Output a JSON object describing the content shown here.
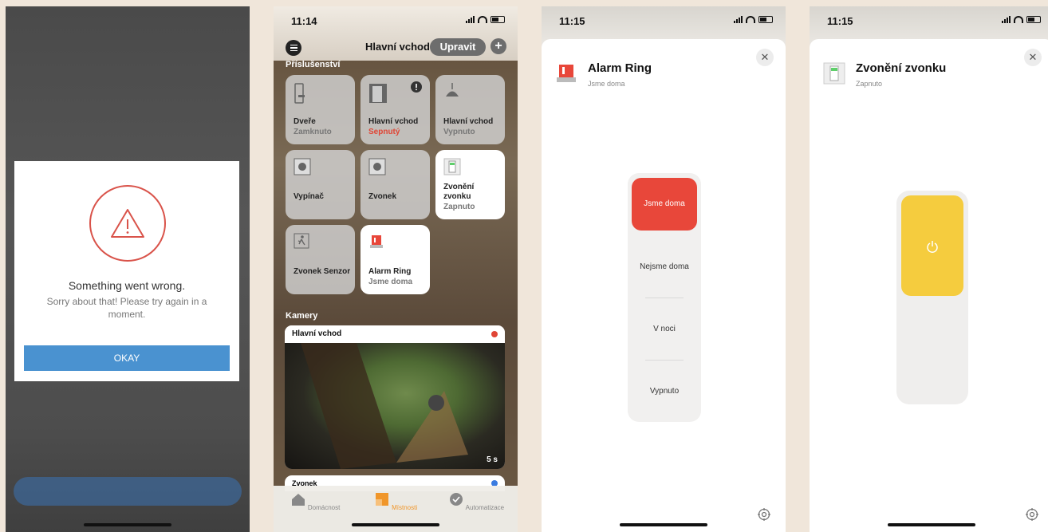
{
  "error_screen": {
    "title": "Something went wrong.",
    "message": "Sorry about that! Please try again in a moment.",
    "okay_label": "OKAY"
  },
  "home_screen": {
    "status_time": "11:14",
    "room_title": "Hlavní vchod",
    "edit_label": "Upravit",
    "accessories_label": "Příslušenství",
    "tiles": [
      {
        "name": "Dveře",
        "state": "Zamknuto"
      },
      {
        "name": "Hlavní vchod",
        "state": "Sepnutý"
      },
      {
        "name": "Hlavní vchod",
        "state": "Vypnuto"
      },
      {
        "name": "Vypínač",
        "state": ""
      },
      {
        "name": "Zvonek",
        "state": ""
      },
      {
        "name": "Zvonění zvonku",
        "state": "Zapnuto"
      },
      {
        "name": "Zvonek Senzor",
        "state": ""
      },
      {
        "name": "Alarm Ring",
        "state": "Jsme doma"
      }
    ],
    "cameras_label": "Kamery",
    "camera1_name": "Hlavní vchod",
    "camera1_time": "5 s",
    "camera2_name": "Zvonek",
    "tabs": {
      "home": "Domácnost",
      "rooms": "Místnosti",
      "automation": "Automatizace"
    },
    "active_tab": "rooms"
  },
  "alarm_screen": {
    "status_time": "11:15",
    "title": "Alarm Ring",
    "subtitle": "Jsme doma",
    "modes": [
      "Jsme doma",
      "Nejsme doma",
      "V noci",
      "Vypnuto"
    ],
    "selected_mode": "Jsme doma"
  },
  "doorbell_screen": {
    "status_time": "11:15",
    "title": "Zvonění zvonku",
    "subtitle": "Zapnuto",
    "switch_on": true
  },
  "colors": {
    "alarm_red": "#e8473a",
    "switch_yellow": "#f5cc3e",
    "okay_blue": "#4a92d0",
    "active_tab_orange": "#f0962a"
  }
}
